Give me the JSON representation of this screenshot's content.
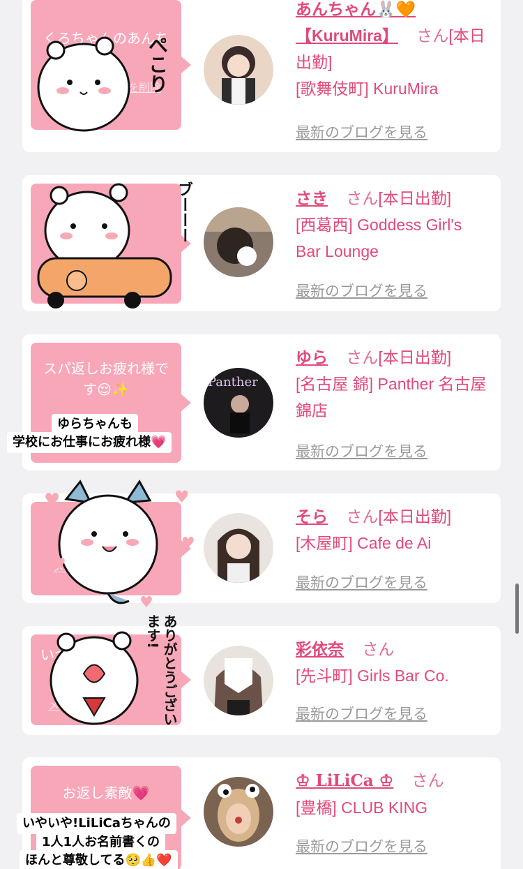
{
  "cards": [
    {
      "bubble_text": "くろちゃんのあんち",
      "bubble_delete": "を削除",
      "name": "あんちゃん🐰🧡【KuruMira】",
      "san": "さん",
      "status": "[本日出勤]",
      "shop": "[歌舞伎町] KuruMira",
      "blog": "最新のブログを見る"
    },
    {
      "bubble_text": "",
      "bubble_delete": "",
      "name": "さき",
      "san": "さん",
      "status": "[本日出勤]",
      "shop": "[西葛西] Goddess Girl's Bar Lounge",
      "blog": "最新のブログを見る"
    },
    {
      "bubble_text": "スパ返しお疲れ様です😌✨",
      "bubble_delete": "",
      "name": "ゆら",
      "san": "さん",
      "status": "[本日出勤]",
      "shop": "[名古屋 錦] Panther 名古屋錦店",
      "blog": "最新のブログを見る"
    },
    {
      "bubble_text": "",
      "bubble_delete": "メッ",
      "name": "そら",
      "san": "さん",
      "status": "[本日出勤]",
      "shop": "[木屋町] Cafe de Ai",
      "blog": "最新のブログを見る"
    },
    {
      "bubble_text": "いつ",
      "bubble_delete": "メ",
      "name": "彩依奈",
      "san": "さん",
      "status": "",
      "shop": "[先斗町] Girls Bar Co.",
      "blog": "最新のブログを見る"
    },
    {
      "bubble_text": "お返し素敵💗",
      "bubble_delete": "",
      "name": "♔ LiLiCa ♔",
      "san": "さん",
      "status": "",
      "shop": "[豊橋] CLUB KING",
      "blog": "最新のブログを見る"
    }
  ],
  "stickers": {
    "peko": "ぺこり",
    "boo": "ブーーー",
    "thanks": "ありがとうございます!"
  },
  "captions": {
    "yura_line1": "ゆらちゃんも",
    "yura_line2": "学校にお仕事にお疲れ様💗",
    "lilica_line1": "いやいや!LiLiCaちゃんの",
    "lilica_line2": "1人1人お名前書くの",
    "lilica_line3": "ほんと尊敬してる🥺👍❤️"
  },
  "colors": {
    "accent": "#e1497a",
    "bubble": "#f7a7b8",
    "link_gray": "#9a9a9a"
  }
}
